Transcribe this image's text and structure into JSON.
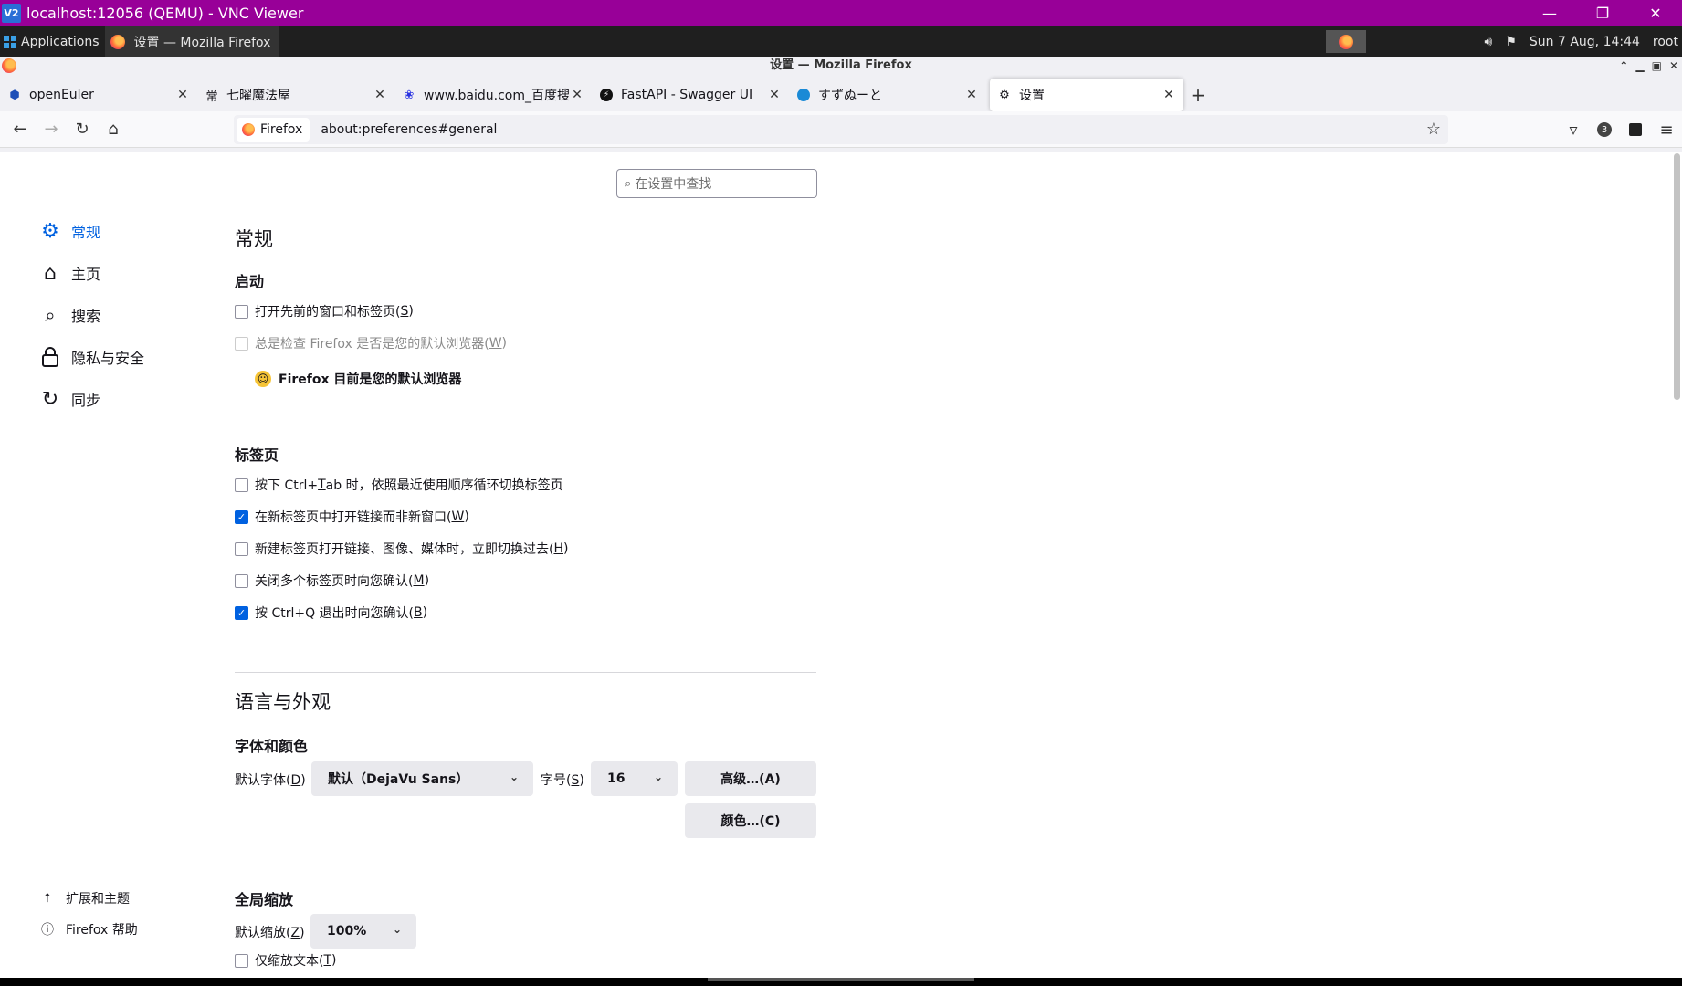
{
  "vnc": {
    "title": "localhost:12056 (QEMU) - VNC Viewer",
    "logo": "V2"
  },
  "panel": {
    "applications": "Applications",
    "task_title": "设置 — Mozilla Firefox",
    "clock": "Sun  7 Aug, 14:44",
    "user": "root"
  },
  "window": {
    "title": "设置 — Mozilla Firefox"
  },
  "tabs": [
    {
      "label": "openEuler",
      "icon": "openeuler-icon"
    },
    {
      "label": "七曜魔法屋",
      "icon": "kanji-icon",
      "glyph": "常"
    },
    {
      "label": "www.baidu.com_百度搜索",
      "icon": "baidu-paw-icon"
    },
    {
      "label": "FastAPI - Swagger UI",
      "icon": "fastapi-bolt-icon"
    },
    {
      "label": "すずぬーと",
      "icon": "globe-icon"
    },
    {
      "label": "设置",
      "icon": "gear-icon"
    }
  ],
  "urlbar": {
    "identity": "Firefox",
    "url": "about:preferences#general"
  },
  "toolbar": {
    "badge_count": "3"
  },
  "search": {
    "placeholder": "在设置中查找"
  },
  "sidebar": {
    "items": [
      {
        "label": "常规",
        "icon": "gear-icon",
        "selected": true
      },
      {
        "label": "主页",
        "icon": "home-icon"
      },
      {
        "label": "搜索",
        "icon": "search-icon"
      },
      {
        "label": "隐私与安全",
        "icon": "lock-icon"
      },
      {
        "label": "同步",
        "icon": "sync-icon"
      }
    ],
    "footer": [
      {
        "label": "扩展和主题",
        "icon": "puzzle-icon"
      },
      {
        "label": "Firefox 帮助",
        "icon": "help-icon"
      }
    ]
  },
  "general": {
    "heading": "常规",
    "startup": {
      "heading": "启动",
      "restore_label": "打开先前的窗口和标签页(",
      "restore_key": "S",
      "default_check_label": "总是检查 Firefox 是否是您的默认浏览器(",
      "default_check_key": "W",
      "default_status": "Firefox 目前是您的默认浏览器"
    },
    "tabs": {
      "heading": "标签页",
      "items": [
        {
          "pre": "按下 Ctrl+",
          "key": "T",
          "post": "ab 时，依照最近使用顺序循环切换标签页",
          "checked": false
        },
        {
          "pre": "在新标签页中打开链接而非新窗口(",
          "key": "W",
          "post": ")",
          "checked": true
        },
        {
          "pre": "新建标签页打开链接、图像、媒体时，立即切换过去(",
          "key": "H",
          "post": ")",
          "checked": false
        },
        {
          "pre": "关闭多个标签页时向您确认(",
          "key": "M",
          "post": ")",
          "checked": false
        },
        {
          "pre": "按 Ctrl+Q 退出时向您确认(",
          "key": "B",
          "post": ")",
          "checked": true
        }
      ]
    }
  },
  "language": {
    "heading": "语言与外观",
    "fonts": {
      "heading": "字体和颜色",
      "default_font_label": "默认字体(",
      "default_font_key": "D",
      "default_font_value": "默认（DejaVu Sans）",
      "size_label": "字号(",
      "size_key": "S",
      "size_value": "16",
      "advanced_button": "高级…(A)",
      "colors_button": "颜色…(C)"
    },
    "zoom": {
      "heading": "全局缩放",
      "default_zoom_label": "默认缩放(",
      "default_zoom_key": "Z",
      "default_zoom_value": "100%",
      "text_only_label": "仅缩放文本(",
      "text_only_key": "T"
    }
  },
  "colors": {
    "accent": "#0061e0",
    "vnc_bar": "#980098"
  }
}
